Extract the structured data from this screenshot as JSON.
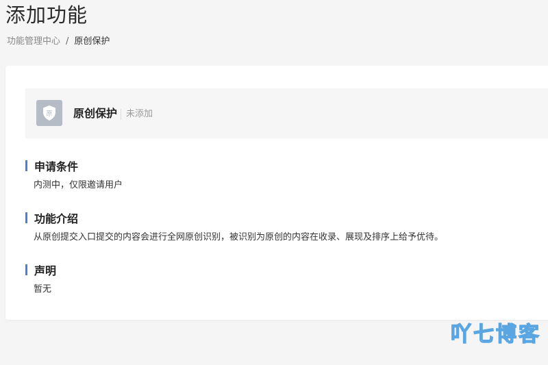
{
  "page": {
    "title": "添加功能"
  },
  "breadcrumb": {
    "parent": "功能管理中心",
    "separator": "/",
    "current": "原创保护"
  },
  "feature": {
    "icon": "shield-icon",
    "icon_char": "原",
    "icon_bg": "#b5bcc6",
    "name": "原创保护",
    "status": "未添加"
  },
  "sections": [
    {
      "heading": "申请条件",
      "body": "内测中，仅限邀请用户"
    },
    {
      "heading": "功能介绍",
      "body": "从原创提交入口提交的内容会进行全网原创识别，被识别为原创的内容在收录、展现及排序上给予优待。"
    },
    {
      "heading": "声明",
      "body": "暂无"
    }
  ],
  "colors": {
    "accent": "#4a7fd6",
    "watermark": "#4a9ee0"
  },
  "watermark": {
    "text": "吖七博客"
  }
}
